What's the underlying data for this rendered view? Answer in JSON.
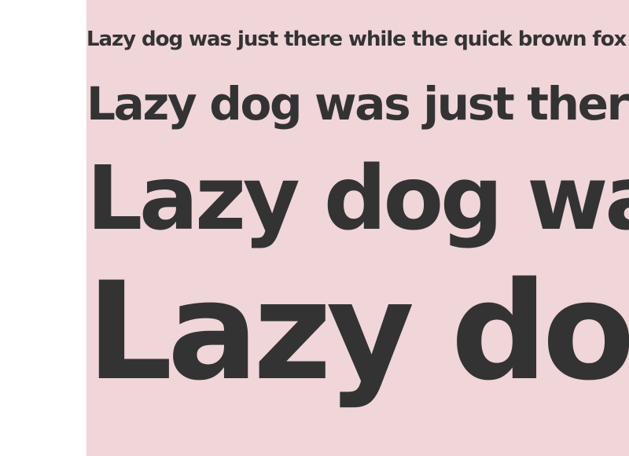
{
  "colors": {
    "page_background": "#ffffff",
    "specimen_background": "#f0d5d9",
    "text": "#333333"
  },
  "specimen": {
    "lines": [
      "Lazy dog was just there while the quick brown fox was jumping",
      "Lazy dog was just there while the quick brown fox",
      "Lazy dog was just there",
      "Lazy dog was"
    ]
  }
}
